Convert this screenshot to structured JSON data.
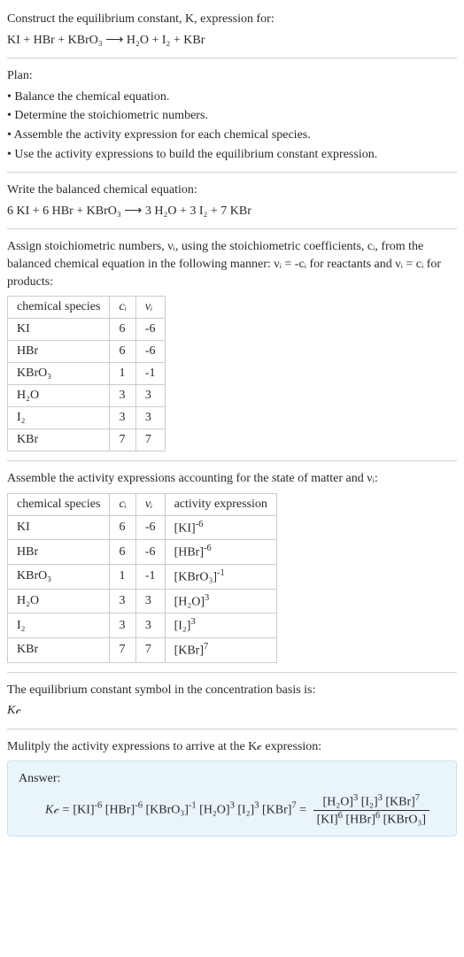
{
  "q_line1": "Construct the equilibrium constant, K, expression for:",
  "q_line2": "KI + HBr + KBrO₃ ⟶ H₂O + I₂ + KBr",
  "plan_label": "Plan:",
  "plan_items": [
    "• Balance the chemical equation.",
    "• Determine the stoichiometric numbers.",
    "• Assemble the activity expression for each chemical species.",
    "• Use the activity expressions to build the equilibrium constant expression."
  ],
  "balanced_label": "Write the balanced chemical equation:",
  "balanced_eq": "6 KI + 6 HBr + KBrO₃ ⟶ 3 H₂O + 3 I₂ + 7 KBr",
  "stoich_text_1": "Assign stoichiometric numbers, νᵢ, using the stoichiometric coefficients, cᵢ, from the balanced chemical equation in the following manner: νᵢ = -cᵢ for reactants and νᵢ = cᵢ for products:",
  "table1": {
    "headers": [
      "chemical species",
      "cᵢ",
      "νᵢ"
    ],
    "rows": [
      [
        "KI",
        "6",
        "-6"
      ],
      [
        "HBr",
        "6",
        "-6"
      ],
      [
        "KBrO₃",
        "1",
        "-1"
      ],
      [
        "H₂O",
        "3",
        "3"
      ],
      [
        "I₂",
        "3",
        "3"
      ],
      [
        "KBr",
        "7",
        "7"
      ]
    ]
  },
  "assemble_text": "Assemble the activity expressions accounting for the state of matter and νᵢ:",
  "table2": {
    "headers": [
      "chemical species",
      "cᵢ",
      "νᵢ",
      "activity expression"
    ],
    "rows": [
      {
        "sp": "KI",
        "c": "6",
        "v": "-6",
        "ae_base": "[KI]",
        "ae_exp": "-6"
      },
      {
        "sp": "HBr",
        "c": "6",
        "v": "-6",
        "ae_base": "[HBr]",
        "ae_exp": "-6"
      },
      {
        "sp": "KBrO₃",
        "c": "1",
        "v": "-1",
        "ae_base": "[KBrO₃]",
        "ae_exp": "-1"
      },
      {
        "sp": "H₂O",
        "c": "3",
        "v": "3",
        "ae_base": "[H₂O]",
        "ae_exp": "3"
      },
      {
        "sp": "I₂",
        "c": "3",
        "v": "3",
        "ae_base": "[I₂]",
        "ae_exp": "3"
      },
      {
        "sp": "KBr",
        "c": "7",
        "v": "7",
        "ae_base": "[KBr]",
        "ae_exp": "7"
      }
    ]
  },
  "kc_line1": "The equilibrium constant symbol in the concentration basis is:",
  "kc_line2": "K𝒸",
  "multiply_text": "Mulitply the activity expressions to arrive at the K𝒸 expression:",
  "answer_label": "Answer:",
  "answer": {
    "lhs": "K𝒸 = ",
    "prod_terms": [
      {
        "base": "[KI]",
        "exp": "-6"
      },
      {
        "base": "[HBr]",
        "exp": "-6"
      },
      {
        "base": "[KBrO₃]",
        "exp": "-1"
      },
      {
        "base": "[H₂O]",
        "exp": "3"
      },
      {
        "base": "[I₂]",
        "exp": "3"
      },
      {
        "base": "[KBr]",
        "exp": "7"
      }
    ],
    "num_terms": [
      {
        "base": "[H₂O]",
        "exp": "3"
      },
      {
        "base": "[I₂]",
        "exp": "3"
      },
      {
        "base": "[KBr]",
        "exp": "7"
      }
    ],
    "den_terms": [
      {
        "base": "[KI]",
        "exp": "6"
      },
      {
        "base": "[HBr]",
        "exp": "6"
      },
      {
        "base": "[KBrO₃]",
        "exp": ""
      }
    ]
  }
}
